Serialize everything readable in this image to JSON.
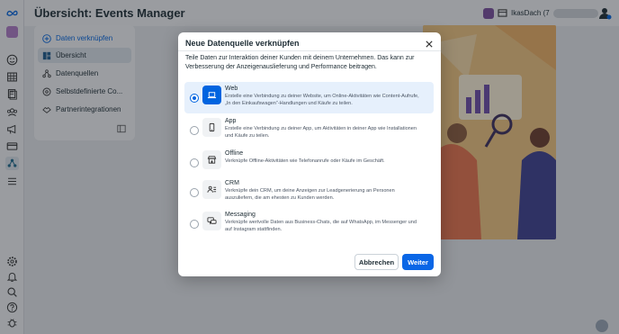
{
  "header": {
    "title": "Übersicht: Events Manager",
    "account_name": "IkasDach (7"
  },
  "sidebar": {
    "items": [
      {
        "label": "Daten verknüpfen",
        "icon": "plus-circle-icon"
      },
      {
        "label": "Übersicht",
        "icon": "dashboard-icon"
      },
      {
        "label": "Datenquellen",
        "icon": "data-sources-icon"
      },
      {
        "label": "Selbstdefinierte Co...",
        "icon": "custom-conversions-icon"
      },
      {
        "label": "Partnerintegrationen",
        "icon": "partner-icon"
      }
    ]
  },
  "modal": {
    "title": "Neue Datenquelle verknüpfen",
    "description": "Teile Daten zur Interaktion deiner Kunden mit deinem Unternehmen. Das kann zur Verbesserung der Anzeigenauslieferung und Performance beitragen.",
    "options": [
      {
        "name": "Web",
        "text": "Erstelle eine Verbindung zu deiner Website, um Online-Aktivitäten wie Content-Aufrufe, „In den Einkaufswagen“-Handlungen und Käufe zu teilen.",
        "icon": "laptop-icon",
        "selected": true
      },
      {
        "name": "App",
        "text": "Erstelle eine Verbindung zu deiner App, um Aktivitäten in deiner App wie Installationen und Käufe zu teilen.",
        "icon": "phone-icon",
        "selected": false
      },
      {
        "name": "Offline",
        "text": "Verknüpfe Offline-Aktivitäten wie Telefonanrufe oder Käufe im Geschäft.",
        "icon": "store-icon",
        "selected": false
      },
      {
        "name": "CRM",
        "text": "Verknüpfe dein CRM, um deine Anzeigen zur Leadgenerierung an Personen auszuliefern, die am ehesten zu Kunden werden.",
        "icon": "crm-icon",
        "selected": false
      },
      {
        "name": "Messaging",
        "text": "Verknüpfe wertvolle Daten aus Business-Chats, die auf WhatsApp, im Messenger und auf Instagram stattfinden.",
        "icon": "chat-icon",
        "selected": false
      }
    ],
    "cancel_label": "Abbrechen",
    "next_label": "Weiter"
  },
  "colors": {
    "accent": "#0064e0",
    "button_primary": "#0a66e6",
    "selected_bg": "#e6f0fc",
    "overlay": "rgba(28,33,40,0.42)"
  }
}
